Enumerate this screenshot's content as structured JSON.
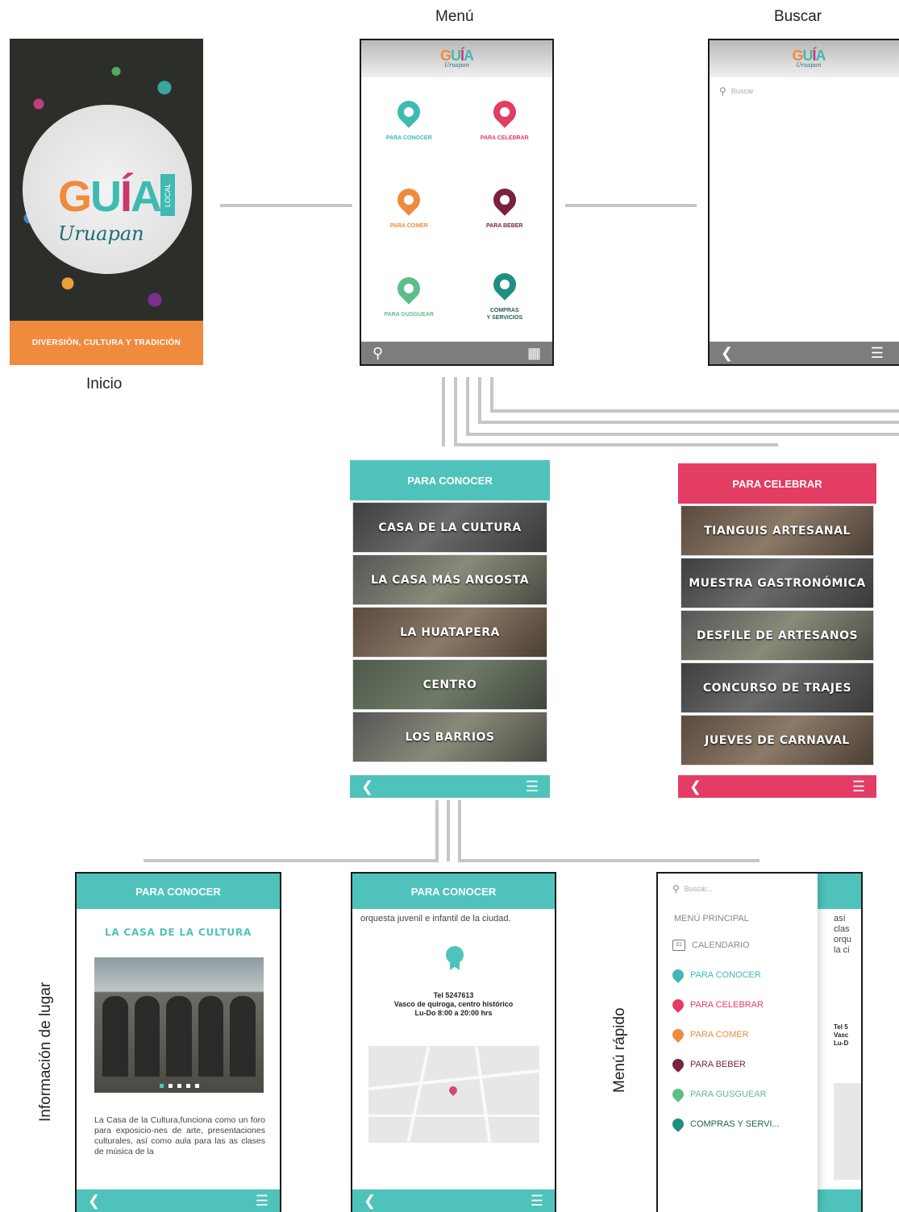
{
  "captions": {
    "menu": "Menú",
    "buscar": "Buscar",
    "inicio": "Inicio",
    "info_lugar": "Información de lugar",
    "menu_rapido": "Menú rápido"
  },
  "logo": {
    "g": "G",
    "u": "U",
    "i": "Í",
    "a": "A",
    "local": "LOCAL",
    "script": "Uruapan"
  },
  "splash": {
    "footer": "DIVERSIÓN, CULTURA Y TRADICIÓN"
  },
  "menu_screen": {
    "items": [
      {
        "label": "PARA CONOCER",
        "color": "#3fbab3"
      },
      {
        "label": "PARA CELEBRAR",
        "color": "#e33d63"
      },
      {
        "label": "PARA COMER",
        "color": "#f08a3c"
      },
      {
        "label": "PARA BEBER",
        "color": "#7a2140"
      },
      {
        "label": "PARA GUSGUEAR",
        "color": "#5cbf8a"
      },
      {
        "label_line1": "COMPRAS",
        "label_line2": "Y SERVICIOS",
        "color": "#1f8f7f"
      }
    ]
  },
  "search_screen": {
    "placeholder": "Buscar"
  },
  "conocer_list": {
    "title": "PARA CONOCER",
    "items": [
      "CASA DE LA CULTURA",
      "LA CASA MÁS ANGOSTA",
      "LA HUATAPERA",
      "CENTRO",
      "LOS BARRIOS"
    ]
  },
  "celebrar_list": {
    "title": "PARA CELEBRAR",
    "items": [
      "TIANGUIS ARTESANAL",
      "MUESTRA GASTRONÓMICA",
      "DESFILE DE ARTESANOS",
      "CONCURSO DE TRAJES",
      "JUEVES DE CARNAVAL"
    ]
  },
  "info_screen": {
    "header": "PARA CONOCER",
    "title": "LA CASA DE LA CULTURA",
    "text": "La Casa de la Cultura,funciona como un foro para exposicio-nes de arte, presentaciones culturales, así como aula para las as clases de música de la"
  },
  "contact_screen": {
    "header": "PARA CONOCER",
    "text": "orquesta juvenil e infantil de la ciudad.",
    "tel": "Tel 5247613",
    "address": "Vasco de quiroga, centro histórico",
    "hours": "Lu-Do 8:00 a 20:00 hrs"
  },
  "quick_menu": {
    "placeholder": "Buscar...",
    "title": "MENÚ PRINCIPAL",
    "calendar": "CALENDARIO",
    "items": [
      {
        "label": "PARA CONOCER",
        "color": "#3fbab3"
      },
      {
        "label": "PARA CELEBRAR",
        "color": "#e33d63"
      },
      {
        "label": "PARA COMER",
        "color": "#f08a3c"
      },
      {
        "label": "PARA BEBER",
        "color": "#7a2140"
      },
      {
        "label": "PARA GUSGUEAR",
        "color": "#5cbf8a"
      },
      {
        "label": "COMPRAS Y SERVI...",
        "color": "#1f8f7f"
      }
    ],
    "peek_text": "así clas orqu la ci",
    "peek_tel": "Tel 5 Vasc Lu-D"
  },
  "colors": {
    "teal": "#4fc3bb",
    "pink": "#e33d63",
    "orange": "#f08a3c",
    "connector": "#c6c6c6"
  }
}
